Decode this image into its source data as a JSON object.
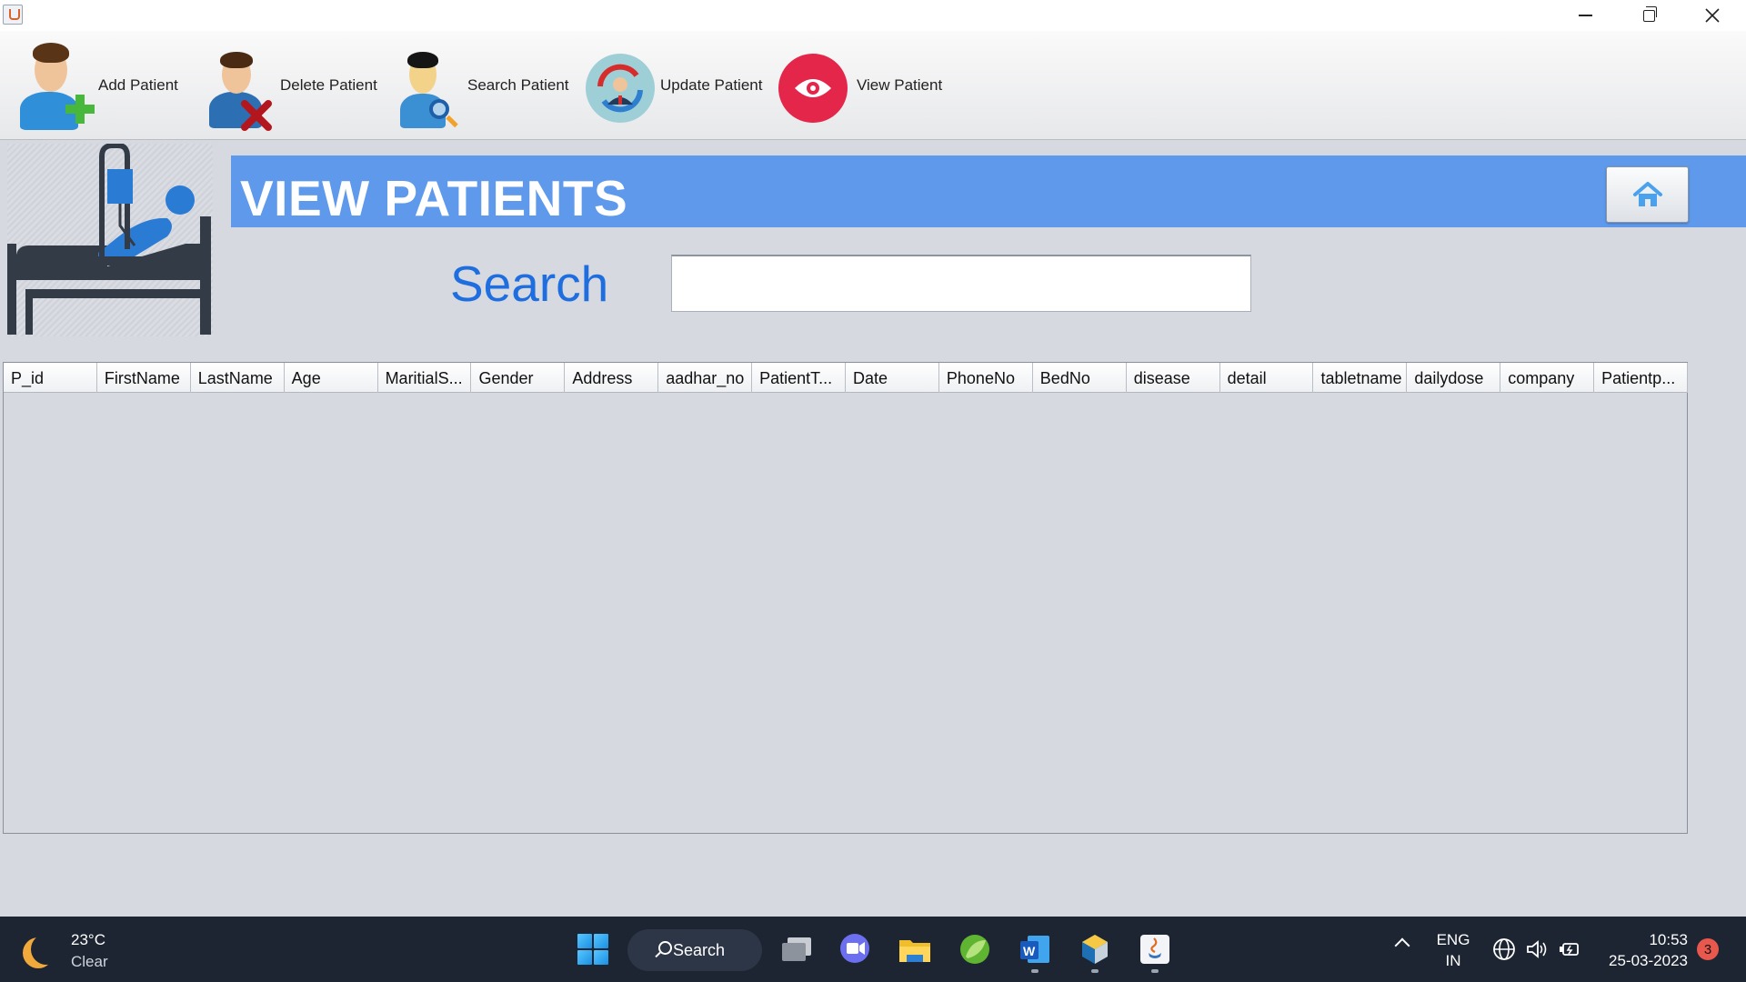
{
  "toolbar": {
    "items": [
      {
        "label": "Add Patient",
        "icon": "add-patient-icon"
      },
      {
        "label": "Delete Patient",
        "icon": "delete-patient-icon"
      },
      {
        "label": "Search Patient",
        "icon": "search-patient-icon"
      },
      {
        "label": "Update Patient",
        "icon": "update-patient-icon"
      },
      {
        "label": "View Patient",
        "icon": "view-patient-icon"
      }
    ]
  },
  "header": {
    "title": "VIEW PATIENTS",
    "home_icon": "home-icon",
    "color": "#5e99eb"
  },
  "search": {
    "label": "Search",
    "value": ""
  },
  "table": {
    "columns": [
      "P_id",
      "FirstName",
      "LastName",
      "Age",
      "MaritialS...",
      "Gender",
      "Address",
      "aadhar_no",
      "PatientT...",
      "Date",
      "PhoneNo",
      "BedNo",
      "disease",
      "detail",
      "tabletname",
      "dailydose",
      "company",
      "Patientp..."
    ],
    "rows": []
  },
  "taskbar": {
    "weather": {
      "temp": "23°C",
      "condition": "Clear"
    },
    "search_label": "Search",
    "apps": [
      "task-view-icon",
      "teams-chat-icon",
      "file-explorer-icon",
      "spring-tool-icon",
      "word-icon",
      "netbeans-icon",
      "java-icon"
    ],
    "language": {
      "line1": "ENG",
      "line2": "IN"
    },
    "time": "10:53",
    "date": "25-03-2023",
    "notifications": "3"
  },
  "colors": {
    "accent_blue": "#1f6ee0",
    "header_blue": "#5e99eb",
    "delete_red": "#b3171d",
    "view_red": "#e4264a",
    "taskbar": "#1d2533"
  }
}
